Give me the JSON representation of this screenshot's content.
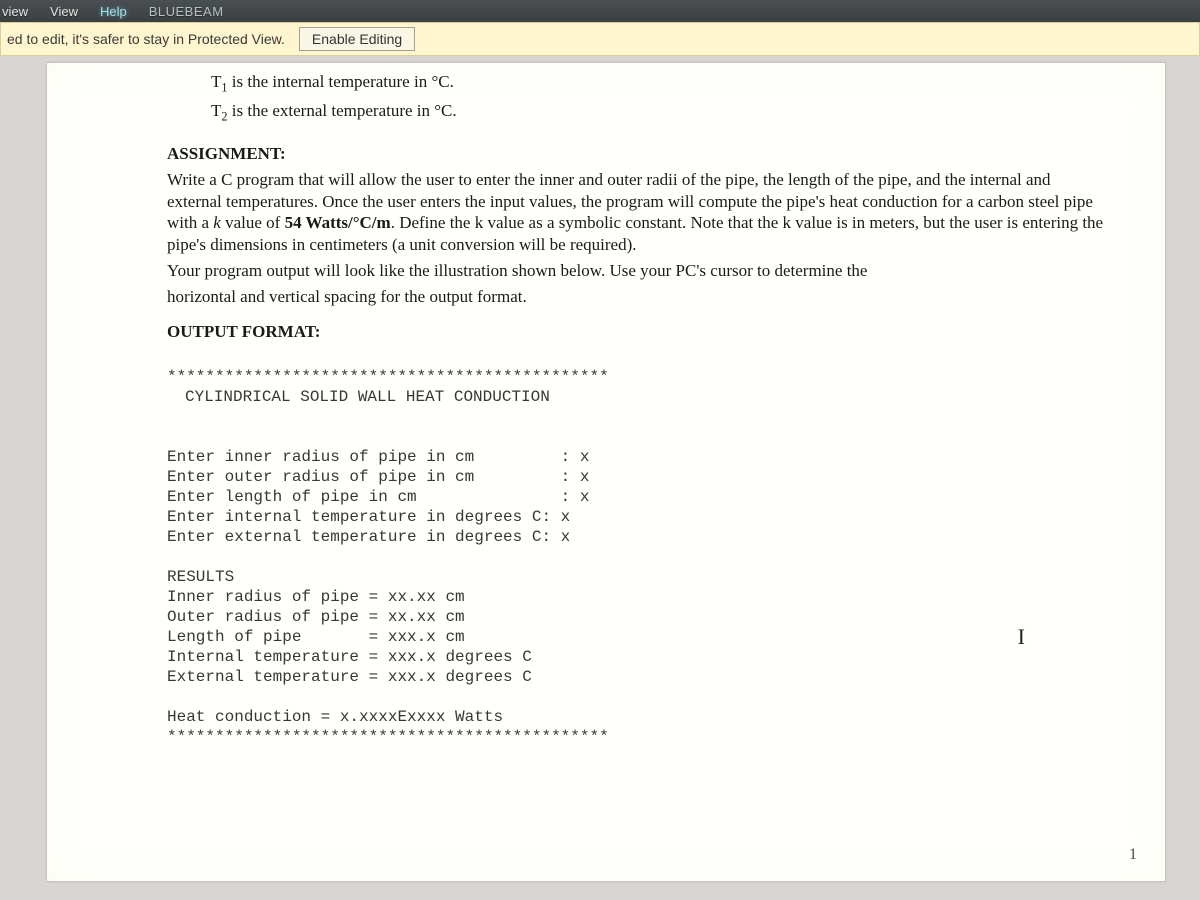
{
  "ribbon": {
    "tab_review": "view",
    "tab_view": "View",
    "tab_help": "Help",
    "tab_bluebeam": "BLUEBEAM"
  },
  "protected_view": {
    "message": "ed to edit, it's safer to stay in Protected View.",
    "button": "Enable Editing"
  },
  "doc": {
    "t1_line": "T₁ is the internal temperature in °C.",
    "t2_line": "T₂ is the external temperature in °C.",
    "assign_heading": "ASSIGNMENT:",
    "assign_body": "Write a C program that will allow the user to enter the inner and outer radii of the pipe, the length of the pipe, and the internal and external temperatures. Once the user enters the input values, the program will compute the pipe's heat conduction for a carbon steel pipe with a k value of 54 Watts/°C/m. Define the k value as a symbolic constant. Note that the k value is in meters, but the user is entering the pipe's dimensions in centimeters (a unit conversion will be required).",
    "assign_output_note1": "Your program output will look like the illustration shown below. Use your PC's cursor to determine the",
    "assign_output_note2": "horizontal and vertical spacing for the output format.",
    "output_heading": "OUTPUT FORMAT:",
    "stars_top": "**********************************************",
    "title_line": "CYLINDRICAL SOLID WALL HEAT CONDUCTION",
    "in1": "Enter inner radius of pipe in cm         : x",
    "in2": "Enter outer radius of pipe in cm         : x",
    "in3": "Enter length of pipe in cm               : x",
    "in4": "Enter internal temperature in degrees C: x",
    "in5": "Enter external temperature in degrees C: x",
    "results_heading": "RESULTS",
    "r1": "Inner radius of pipe = xx.xx cm",
    "r2": "Outer radius of pipe = xx.xx cm",
    "r3": "Length of pipe       = xxx.x cm",
    "r4": "Internal temperature = xxx.x degrees C",
    "r5": "External temperature = xxx.x degrees C",
    "hc": "Heat conduction = x.xxxxExxxx Watts",
    "stars_bot": "**********************************************",
    "page_number": "1",
    "cursor_glyph": "I"
  }
}
